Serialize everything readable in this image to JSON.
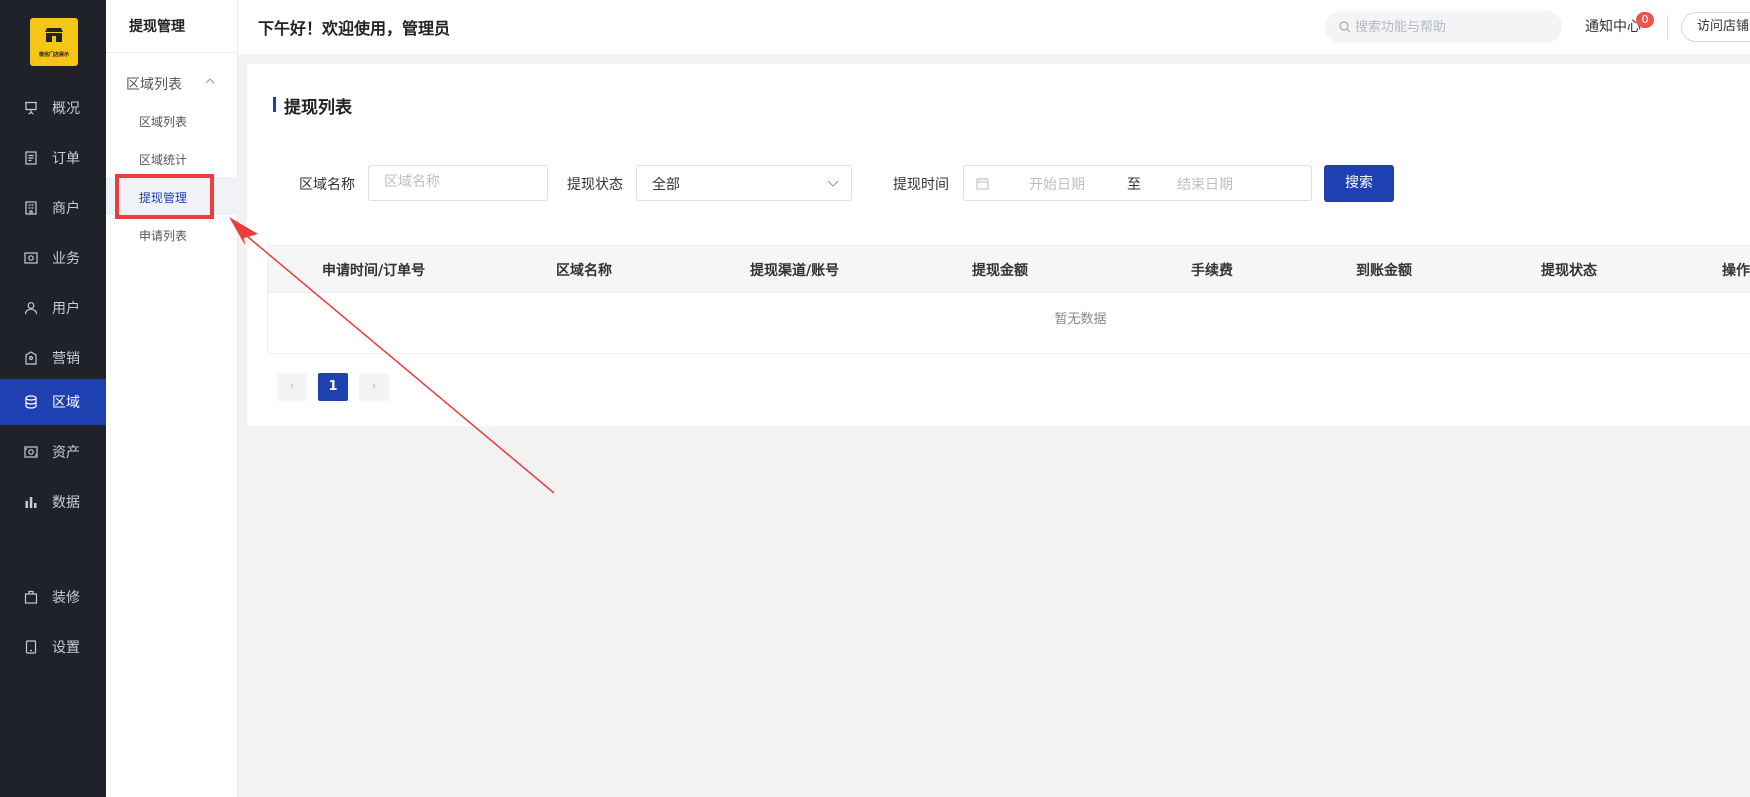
{
  "logo": {
    "text": "微信门店展示"
  },
  "nav": {
    "items": [
      {
        "label": "概况",
        "icon": "presentation-icon"
      },
      {
        "label": "订单",
        "icon": "document-icon"
      },
      {
        "label": "商户",
        "icon": "building-icon"
      },
      {
        "label": "业务",
        "icon": "money-card-icon"
      },
      {
        "label": "用户",
        "icon": "user-icon"
      },
      {
        "label": "营销",
        "icon": "tag-bag-icon"
      },
      {
        "label": "区域",
        "icon": "database-icon"
      },
      {
        "label": "资产",
        "icon": "wallet-icon"
      },
      {
        "label": "数据",
        "icon": "bar-chart-icon"
      },
      {
        "label": "装修",
        "icon": "briefcase-icon"
      },
      {
        "label": "设置",
        "icon": "tablet-icon"
      }
    ],
    "active": "区域"
  },
  "subnav": {
    "title": "提现管理",
    "group": "区域列表",
    "items": [
      "区域列表",
      "区域统计",
      "提现管理",
      "申请列表"
    ],
    "active": "提现管理"
  },
  "header": {
    "greeting": "下午好！欢迎使用，管理员",
    "search_placeholder": "搜索功能与帮助",
    "notice_label": "通知中心",
    "notice_count": "0",
    "visit_label": "访问店铺"
  },
  "page": {
    "title": "提现列表",
    "filters": {
      "region_label": "区域名称",
      "region_placeholder": "区域名称",
      "status_label": "提现状态",
      "status_value": "全部",
      "time_label": "提现时间",
      "start_placeholder": "开始日期",
      "range_sep": "至",
      "end_placeholder": "结束日期",
      "search_button": "搜索"
    },
    "table": {
      "columns": [
        "申请时间/订单号",
        "区域名称",
        "提现渠道/账号",
        "提现金额",
        "手续费",
        "到账金额",
        "提现状态",
        "操作"
      ],
      "empty_text": "暂无数据"
    },
    "pagination": {
      "prev": "‹",
      "current": "1",
      "next": "›"
    }
  },
  "colors": {
    "accent": "#1f40b0",
    "sidebar_bg": "#1f2329",
    "annotation": "#ef3b3b",
    "logo_bg": "#f5c518"
  }
}
